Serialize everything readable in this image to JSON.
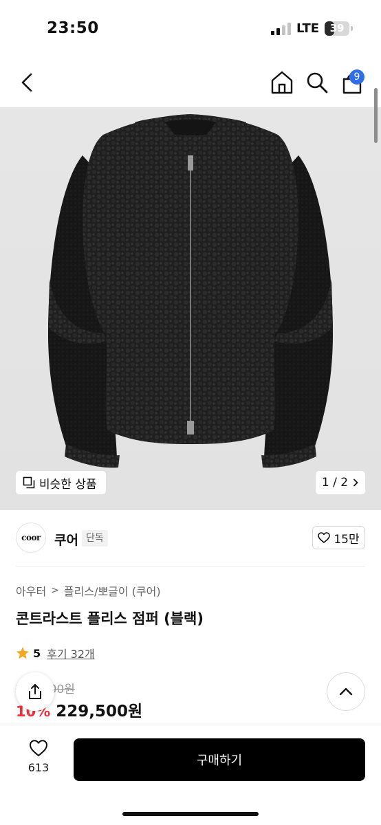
{
  "status_bar": {
    "time": "23:50",
    "network": "LTE",
    "battery": "39",
    "battery_fraction": 0.39
  },
  "nav": {
    "cart_count": "9"
  },
  "gallery": {
    "similar_label": "비슷한 상품",
    "page_indicator": "1 / 2"
  },
  "brand": {
    "logo_text": "coor",
    "name": "쿠어",
    "badge": "단독",
    "likes": "15만"
  },
  "product": {
    "breadcrumb": [
      "아우터",
      "플리스/뽀글이 (쿠어)"
    ],
    "title": "콘트라스트 플리스 점퍼 (블랙)",
    "rating": "5",
    "reviews": "후기 32개",
    "original_price": "255,000원",
    "discount": "10%",
    "price": "229,500원"
  },
  "bottom_bar": {
    "wish_count": "613",
    "buy_label": "구매하기"
  },
  "colors": {
    "accent_blue": "#2f6ee8",
    "discount_red": "#f0303a",
    "star": "#f5a623",
    "buy_button": "#000000"
  },
  "icons": [
    "back-icon",
    "home-icon",
    "search-icon",
    "bag-icon",
    "similar-icon",
    "heart-icon",
    "star-icon",
    "share-icon",
    "chevron-up-icon"
  ]
}
